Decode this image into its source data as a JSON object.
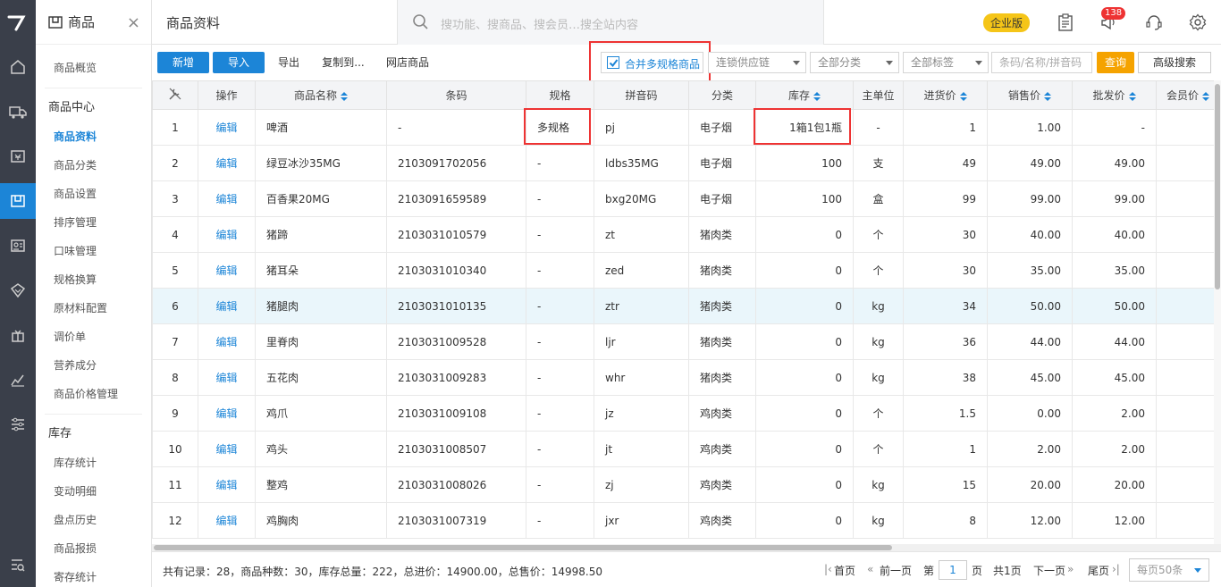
{
  "rail": {
    "icons": [
      "logo-icon",
      "home-icon",
      "truck-icon",
      "cashier-icon",
      "goods-icon",
      "member-card-icon",
      "diamond-icon",
      "gift-icon",
      "chart-icon",
      "sliders-icon",
      "search-list-icon"
    ]
  },
  "sidebar": {
    "title": "商品",
    "items_top": [
      "商品概览"
    ],
    "group1": "商品中心",
    "items1": [
      "商品资料",
      "商品分类",
      "商品设置",
      "排序管理",
      "口味管理",
      "规格换算",
      "原材料配置",
      "调价单",
      "营养成分",
      "商品价格管理"
    ],
    "group2": "库存",
    "items2": [
      "库存统计",
      "变动明细",
      "盘点历史",
      "商品报损",
      "寄存统计"
    ]
  },
  "topbar": {
    "title": "商品资料",
    "search_placeholder": "搜功能、搜商品、搜会员…搜全站内容",
    "edition": "企业版",
    "notif_count": "138"
  },
  "toolbar": {
    "add": "新增",
    "import": "导入",
    "export": "导出",
    "copy_to": "复制到...",
    "online_store": "网店商品",
    "merge_label": "合并多规格商品",
    "merge_checked": true,
    "supply_chain": "连锁供应链",
    "category": "全部分类",
    "tag": "全部标签",
    "code_placeholder": "条码/名称/拼音码",
    "query": "查询",
    "advanced": "高级搜索"
  },
  "table": {
    "headers": [
      "操作",
      "商品名称",
      "条码",
      "规格",
      "拼音码",
      "分类",
      "库存",
      "主单位",
      "进货价",
      "销售价",
      "批发价",
      "会员价"
    ],
    "rows": [
      [
        "1",
        "编辑",
        "啤酒",
        "-",
        "多规格",
        "pj",
        "电子烟",
        "1箱1包1瓶",
        "-",
        "1",
        "1.00",
        "-"
      ],
      [
        "2",
        "编辑",
        "绿豆冰沙35MG",
        "2103091702056",
        "-",
        "ldbs35MG",
        "电子烟",
        "100",
        "支",
        "49",
        "49.00",
        "49.00"
      ],
      [
        "3",
        "编辑",
        "百香果20MG",
        "2103091659589",
        "-",
        "bxg20MG",
        "电子烟",
        "100",
        "盒",
        "99",
        "99.00",
        "99.00"
      ],
      [
        "4",
        "编辑",
        "猪蹄",
        "2103031010579",
        "-",
        "zt",
        "猪肉类",
        "0",
        "个",
        "30",
        "40.00",
        "40.00"
      ],
      [
        "5",
        "编辑",
        "猪耳朵",
        "2103031010340",
        "-",
        "zed",
        "猪肉类",
        "0",
        "个",
        "30",
        "35.00",
        "35.00"
      ],
      [
        "6",
        "编辑",
        "猪腿肉",
        "2103031010135",
        "-",
        "ztr",
        "猪肉类",
        "0",
        "kg",
        "34",
        "50.00",
        "50.00"
      ],
      [
        "7",
        "编辑",
        "里脊肉",
        "2103031009528",
        "-",
        "ljr",
        "猪肉类",
        "0",
        "kg",
        "36",
        "44.00",
        "44.00"
      ],
      [
        "8",
        "编辑",
        "五花肉",
        "2103031009283",
        "-",
        "whr",
        "猪肉类",
        "0",
        "kg",
        "38",
        "45.00",
        "45.00"
      ],
      [
        "9",
        "编辑",
        "鸡爪",
        "2103031009108",
        "-",
        "jz",
        "鸡肉类",
        "0",
        "个",
        "1.5",
        "0.00",
        "2.00"
      ],
      [
        "10",
        "编辑",
        "鸡头",
        "2103031008507",
        "-",
        "jt",
        "鸡肉类",
        "0",
        "个",
        "1",
        "2.00",
        "2.00"
      ],
      [
        "11",
        "编辑",
        "整鸡",
        "2103031008026",
        "-",
        "zj",
        "鸡肉类",
        "0",
        "kg",
        "15",
        "20.00",
        "20.00"
      ],
      [
        "12",
        "编辑",
        "鸡胸肉",
        "2103031007319",
        "-",
        "jxr",
        "鸡肉类",
        "0",
        "kg",
        "8",
        "12.00",
        "12.00"
      ]
    ]
  },
  "footer": {
    "summary": "共有记录：28，商品种数：30，库存总量：222，总进价：14900.00，总售价：14998.50",
    "first": "首页",
    "prev": "前一页",
    "page_pre": "第",
    "page": "1",
    "page_post": "页",
    "total": "共1页",
    "next": "下一页",
    "last": "尾页",
    "page_size": "每页50条"
  },
  "colors": {
    "accent": "#1c85d7",
    "highlight": "#e33",
    "rail": "#3a3f4a"
  }
}
